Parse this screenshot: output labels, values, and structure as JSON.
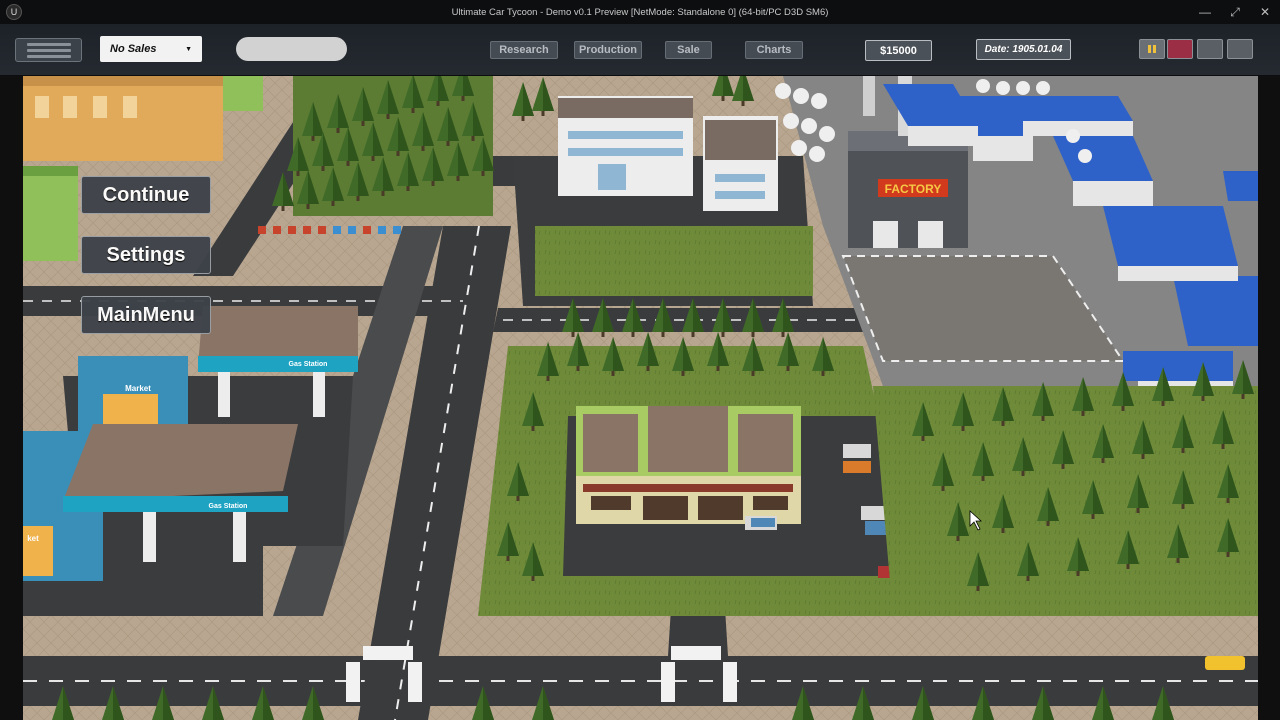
{
  "window": {
    "title": "Ultimate Car Tycoon - Demo v0.1 Preview [NetMode: Standalone 0]  (64-bit/PC D3D SM6)",
    "logo_glyph": "U",
    "minimize_glyph": "—",
    "restore_glyph": "⤢",
    "close_glyph": "✕"
  },
  "hud": {
    "sales_select": {
      "value": "No Sales",
      "caret": "▼"
    },
    "tabs": [
      {
        "label": "Research"
      },
      {
        "label": "Production"
      },
      {
        "label": "Sale"
      },
      {
        "label": "Charts"
      }
    ],
    "money": "$15000",
    "date": "Date: 1905.01.04",
    "controls": [
      {
        "name": "pause",
        "color": "#f0c23b"
      },
      {
        "name": "stop",
        "color": "#9b2e44"
      },
      {
        "name": "blank-1",
        "color": "#5a5f66"
      },
      {
        "name": "blank-2",
        "color": "#5a5f66"
      }
    ]
  },
  "pause_menu": {
    "continue_label": "Continue",
    "settings_label": "Settings",
    "mainmenu_label": "MainMenu"
  },
  "scene_labels": {
    "factory_sign": "FACTORY",
    "market_1": "Market",
    "market_2": "ket",
    "gas_station_1": "Gas Station",
    "gas_station_2": "Gas Station"
  },
  "colors": {
    "hud_bg": "#23272e",
    "button_bg": "#3e434a",
    "ground": "#b5a48f",
    "grass": "#6d8a3a",
    "factory_sign": "#d23a1e"
  }
}
